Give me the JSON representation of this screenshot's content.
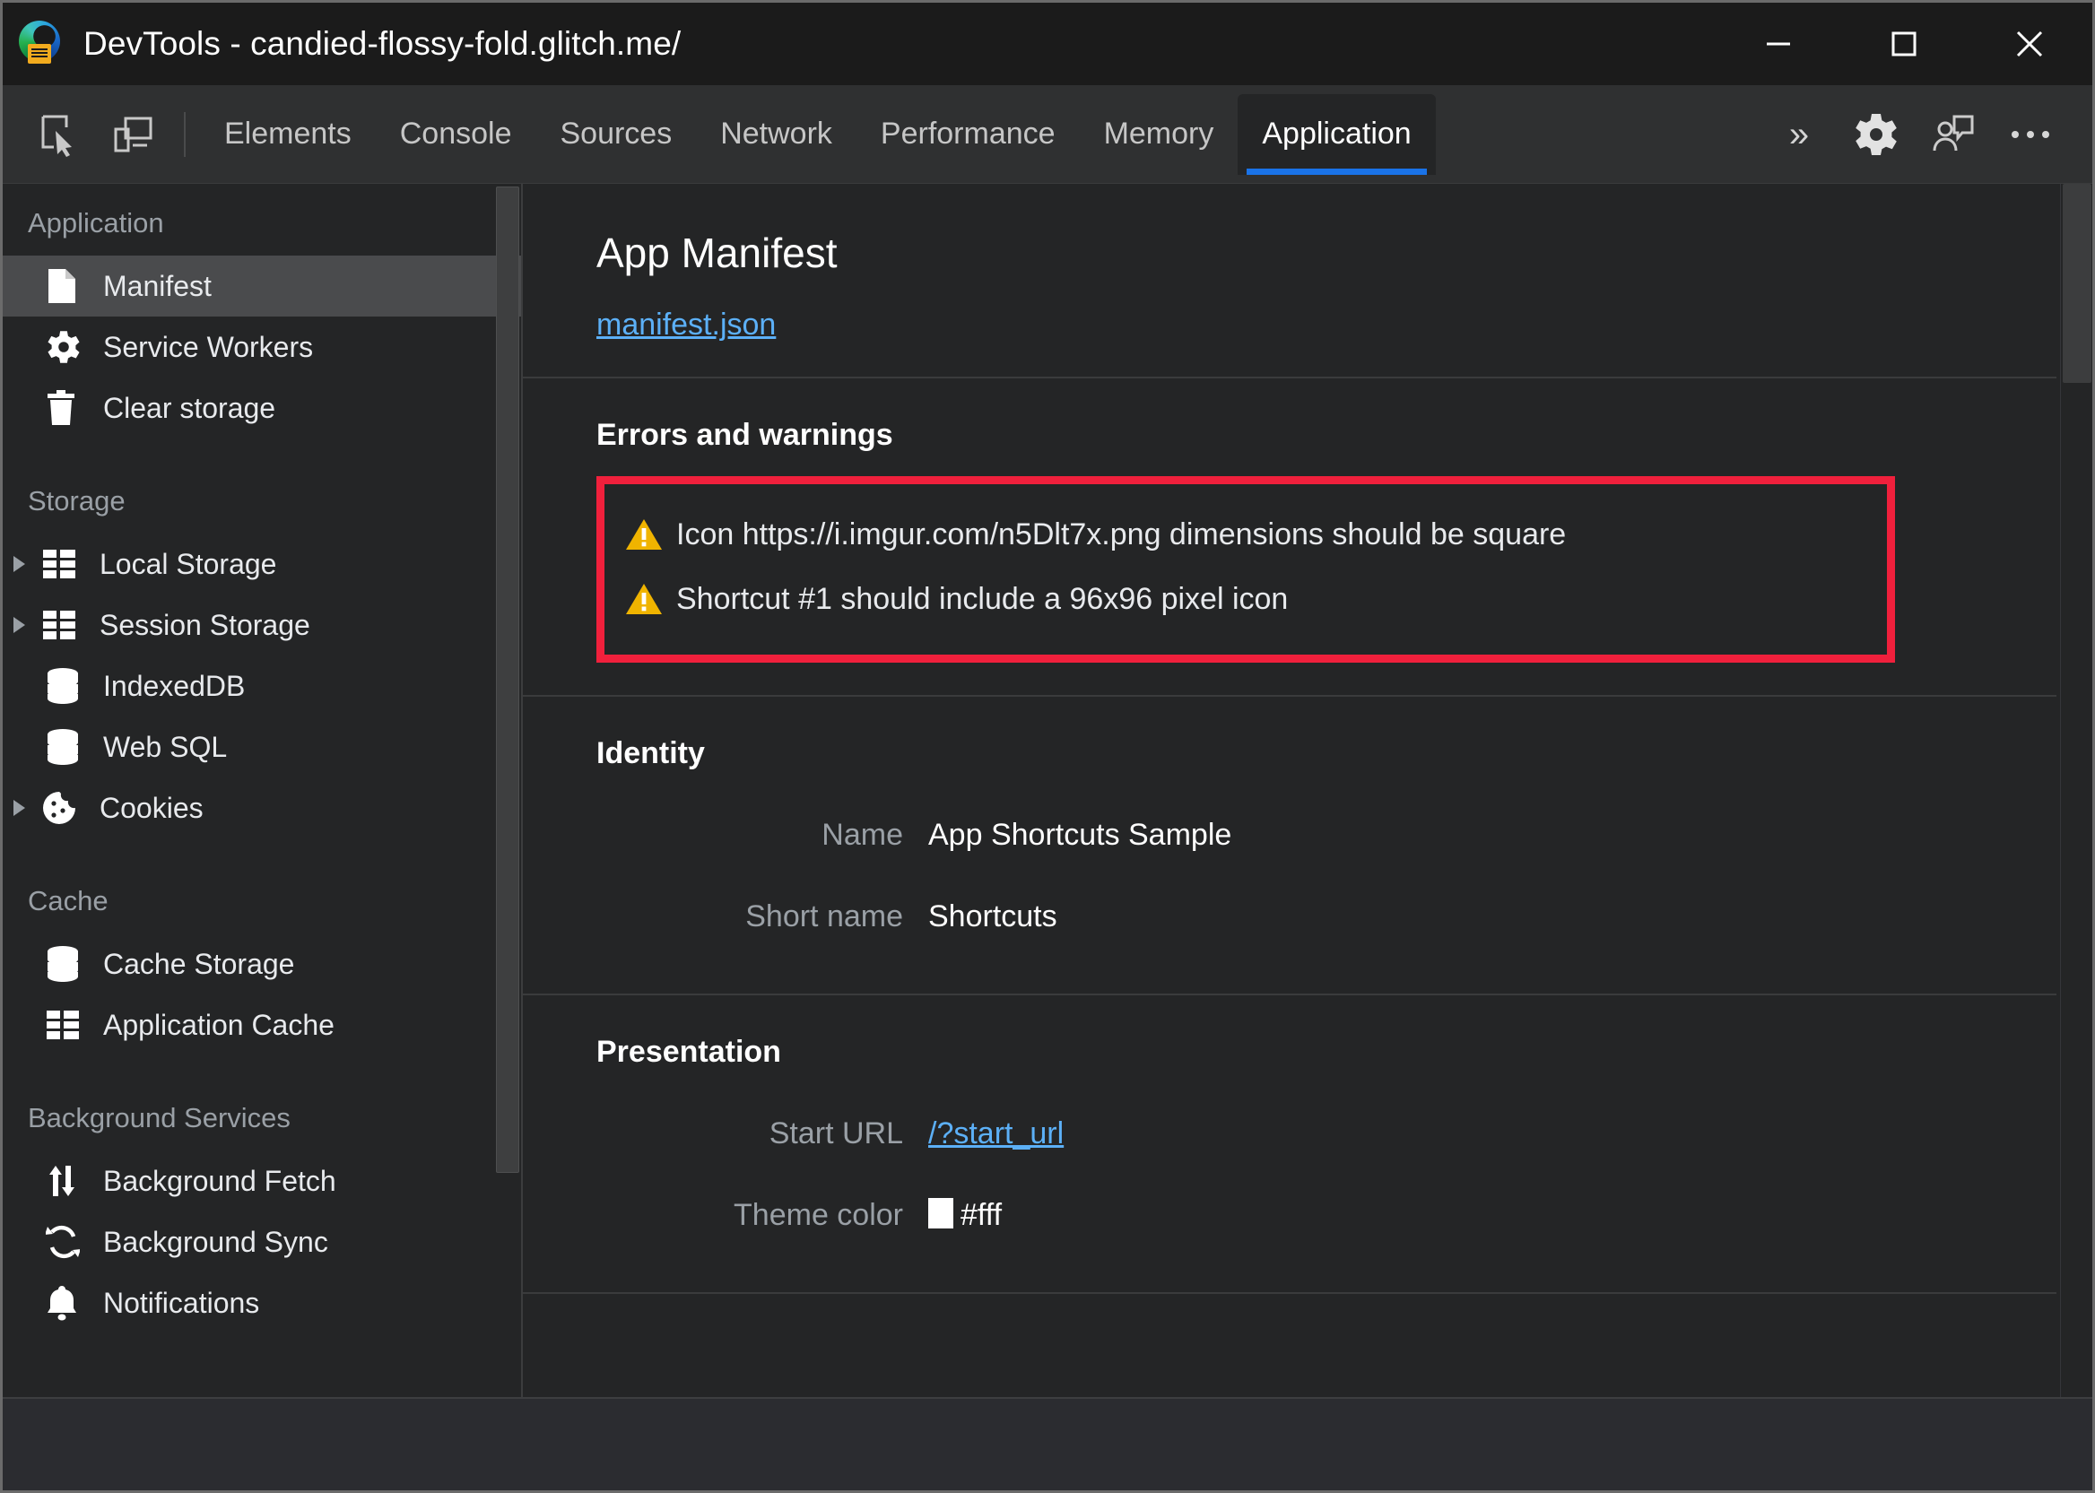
{
  "window": {
    "title": "DevTools - candied-flossy-fold.glitch.me/",
    "logo_icon": "edge-devtools-logo-icon",
    "controls": [
      {
        "name": "minimize-button",
        "icon": "minimize-icon"
      },
      {
        "name": "maximize-button",
        "icon": "maximize-icon"
      },
      {
        "name": "close-button",
        "icon": "close-icon"
      }
    ]
  },
  "toolbar": {
    "left_icons": [
      {
        "name": "inspect-element-icon",
        "label": "Inspect element"
      },
      {
        "name": "device-toolbar-icon",
        "label": "Toggle device toolbar"
      }
    ],
    "tabs": [
      {
        "label": "Elements",
        "active": false
      },
      {
        "label": "Console",
        "active": false
      },
      {
        "label": "Sources",
        "active": false
      },
      {
        "label": "Network",
        "active": false
      },
      {
        "label": "Performance",
        "active": false
      },
      {
        "label": "Memory",
        "active": false
      },
      {
        "label": "Application",
        "active": true
      }
    ],
    "active_tab": "Application",
    "accent_color": "#1a73e8",
    "right_icons": [
      {
        "name": "more-tabs-chevron-icon",
        "glyph": "»"
      },
      {
        "name": "settings-gear-icon"
      },
      {
        "name": "feedback-icon"
      },
      {
        "name": "more-options-icon"
      }
    ]
  },
  "sidebar": {
    "groups": [
      {
        "title": "Application",
        "items": [
          {
            "label": "Manifest",
            "icon": "document-icon",
            "selected": true,
            "expandable": false
          },
          {
            "label": "Service Workers",
            "icon": "gear-icon",
            "selected": false,
            "expandable": false
          },
          {
            "label": "Clear storage",
            "icon": "trash-icon",
            "selected": false,
            "expandable": false
          }
        ]
      },
      {
        "title": "Storage",
        "items": [
          {
            "label": "Local Storage",
            "icon": "table-icon",
            "selected": false,
            "expandable": true
          },
          {
            "label": "Session Storage",
            "icon": "table-icon",
            "selected": false,
            "expandable": true
          },
          {
            "label": "IndexedDB",
            "icon": "database-icon",
            "selected": false,
            "expandable": false
          },
          {
            "label": "Web SQL",
            "icon": "database-icon",
            "selected": false,
            "expandable": false
          },
          {
            "label": "Cookies",
            "icon": "cookie-icon",
            "selected": false,
            "expandable": true
          }
        ]
      },
      {
        "title": "Cache",
        "items": [
          {
            "label": "Cache Storage",
            "icon": "database-icon",
            "selected": false,
            "expandable": false
          },
          {
            "label": "Application Cache",
            "icon": "table-icon",
            "selected": false,
            "expandable": false
          }
        ]
      },
      {
        "title": "Background Services",
        "items": [
          {
            "label": "Background Fetch",
            "icon": "updown-arrows-icon",
            "selected": false,
            "expandable": false
          },
          {
            "label": "Background Sync",
            "icon": "sync-icon",
            "selected": false,
            "expandable": false
          },
          {
            "label": "Notifications",
            "icon": "bell-icon",
            "selected": false,
            "expandable": false
          }
        ]
      }
    ]
  },
  "main": {
    "title": "App Manifest",
    "manifest_link": "manifest.json",
    "errors_section": {
      "heading": "Errors and warnings",
      "highlight_color": "#f0203c",
      "items": [
        {
          "icon": "warning-triangle-icon",
          "text": "Icon https://i.imgur.com/n5Dlt7x.png dimensions should be square"
        },
        {
          "icon": "warning-triangle-icon",
          "text": "Shortcut #1 should include a 96x96 pixel icon"
        }
      ]
    },
    "identity_section": {
      "heading": "Identity",
      "fields": [
        {
          "label": "Name",
          "value": "App Shortcuts Sample",
          "is_link": false
        },
        {
          "label": "Short name",
          "value": "Shortcuts",
          "is_link": false
        }
      ]
    },
    "presentation_section": {
      "heading": "Presentation",
      "fields": [
        {
          "label": "Start URL",
          "value": "/?start_url",
          "is_link": true
        },
        {
          "label": "Theme color",
          "value": "#fff",
          "is_link": false,
          "swatch": "#ffffff"
        }
      ]
    }
  }
}
